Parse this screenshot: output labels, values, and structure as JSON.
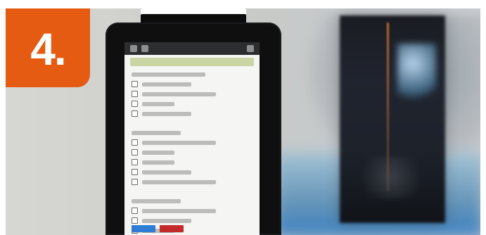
{
  "badge": {
    "label": "4."
  },
  "colors": {
    "badge": "#e55b12",
    "header_bar": "#c9d6a3",
    "button_blue": "#2f7bd6",
    "button_red": "#c32b2b"
  },
  "screen": {
    "rows": [
      {
        "checkbox": true
      },
      {
        "checkbox": true
      },
      {
        "checkbox": true
      },
      {
        "checkbox": true
      },
      {
        "checkbox": true
      },
      {
        "checkbox": true
      },
      {
        "checkbox": true
      },
      {
        "checkbox": true
      },
      {
        "checkbox": true
      },
      {
        "checkbox": true
      },
      {
        "checkbox": true
      },
      {
        "checkbox": true
      }
    ]
  }
}
